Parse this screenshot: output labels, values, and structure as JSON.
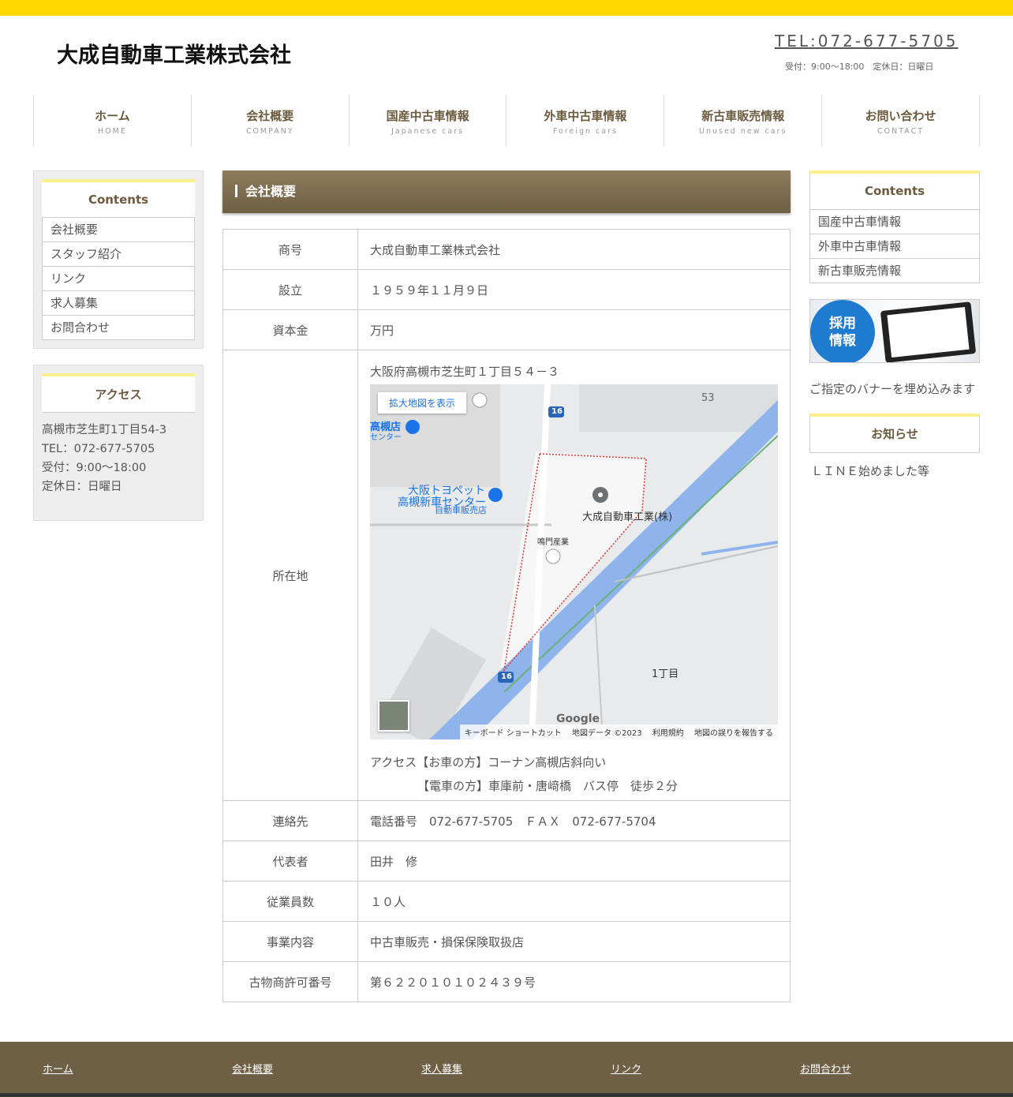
{
  "header": {
    "company": "大成自動車工業株式会社",
    "tel": "TEL:072-677-5705",
    "hours": "受付：9:00～18:00　定休日：日曜日"
  },
  "nav": [
    {
      "label": "ホーム",
      "sub": "HOME"
    },
    {
      "label": "会社概要",
      "sub": "COMPANY"
    },
    {
      "label": "国産中古車情報",
      "sub": "Japanese cars"
    },
    {
      "label": "外車中古車情報",
      "sub": "Foreign cars"
    },
    {
      "label": "新古車販売情報",
      "sub": "Unused new cars"
    },
    {
      "label": "お問い合わせ",
      "sub": "CONTACT"
    }
  ],
  "left_sidebar": {
    "contents_title": "Contents",
    "items": [
      "会社概要",
      "スタッフ紹介",
      "リンク",
      "求人募集",
      "お問合わせ"
    ],
    "access_title": "アクセス",
    "access_lines": [
      "高槻市芝生町1丁目54-3",
      "TEL：072-677-5705",
      "受付：9:00～18:00",
      "定休日：日曜日"
    ]
  },
  "main": {
    "title": "会社概要",
    "rows": [
      {
        "label": "商号",
        "value": "大成自動車工業株式会社"
      },
      {
        "label": "設立",
        "value": "１９５９年１１月９日"
      },
      {
        "label": "資本金",
        "value": "万円"
      },
      {
        "label": "所在地",
        "value": "大阪府高槻市芝生町１丁目５４－３"
      },
      {
        "label": "連絡先",
        "value": "電話番号　072-677-5705　ＦＡＸ　072-677-5704"
      },
      {
        "label": "代表者",
        "value": "田井　修"
      },
      {
        "label": "従業員数",
        "value": "１０人"
      },
      {
        "label": "事業内容",
        "value": "中古車販売・損保保険取扱店"
      },
      {
        "label": "古物商許可番号",
        "value": "第６２２０１０１０２４３９号"
      }
    ],
    "access_car": "アクセス【お車の方】コーナン高槻店斜向い",
    "access_train": "【電車の方】車庫前・唐﨑橋　バス停　徒歩２分",
    "map": {
      "expand_label": "拡大地図を表示",
      "labels": {
        "store1": "高槻店",
        "store1b": "センター",
        "toyopet1": "大阪トヨペット",
        "toyopet2": "高槻新車センター",
        "toyopet3": "自動車販売店",
        "company": "大成自動車工業(株)",
        "naruto": "鳴門産業",
        "chome": "1丁目",
        "num53": "53",
        "route16a": "16",
        "route16b": "16",
        "google": "Google"
      },
      "attribution": [
        "キーボード ショートカット",
        "地図データ ©2023",
        "利用規約",
        "地図の誤りを報告する"
      ]
    }
  },
  "right_sidebar": {
    "contents_title": "Contents",
    "items": [
      "国産中古車情報",
      "外車中古車情報",
      "新古車販売情報"
    ],
    "banner_text": [
      "採用",
      "情報"
    ],
    "banner_caption": "ご指定のバナーを埋め込みます",
    "news_title": "お知らせ",
    "news_text": "ＬＩＮＥ始めました等"
  },
  "footer": [
    "ホーム",
    "会社概要",
    "求人募集",
    "リンク",
    "お問合わせ"
  ],
  "colors": {
    "accent_yellow": "#ffd800",
    "brown": "#6f5f44",
    "nav_text": "#6b5a3d"
  }
}
